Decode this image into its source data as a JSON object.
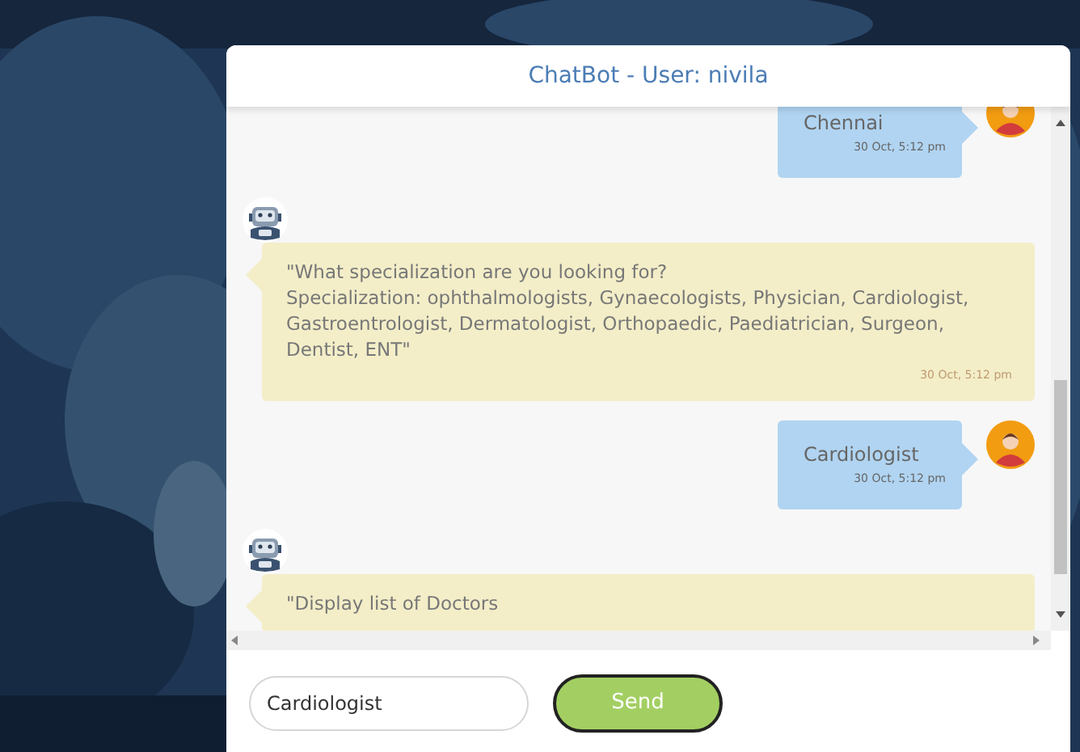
{
  "header": {
    "title": "ChatBot - User: nivila"
  },
  "messages": [
    {
      "kind": "user",
      "text": "Chennai",
      "time": "30 Oct, 5:12 pm"
    },
    {
      "kind": "bot",
      "text": "\"What specialization are you looking for?\nSpecialization: ophthalmologists, Gynaecologists, Physician, Cardiologist, Gastroentrologist, Dermatologist, Orthopaedic, Paediatrician, Surgeon, Dentist, ENT\"",
      "time": "30 Oct, 5:12 pm"
    },
    {
      "kind": "user",
      "text": "Cardiologist",
      "time": "30 Oct, 5:12 pm"
    },
    {
      "kind": "bot",
      "text": "\"Display list of Doctors"
    }
  ],
  "composer": {
    "value": "Cardiologist",
    "send_label": "Send"
  }
}
